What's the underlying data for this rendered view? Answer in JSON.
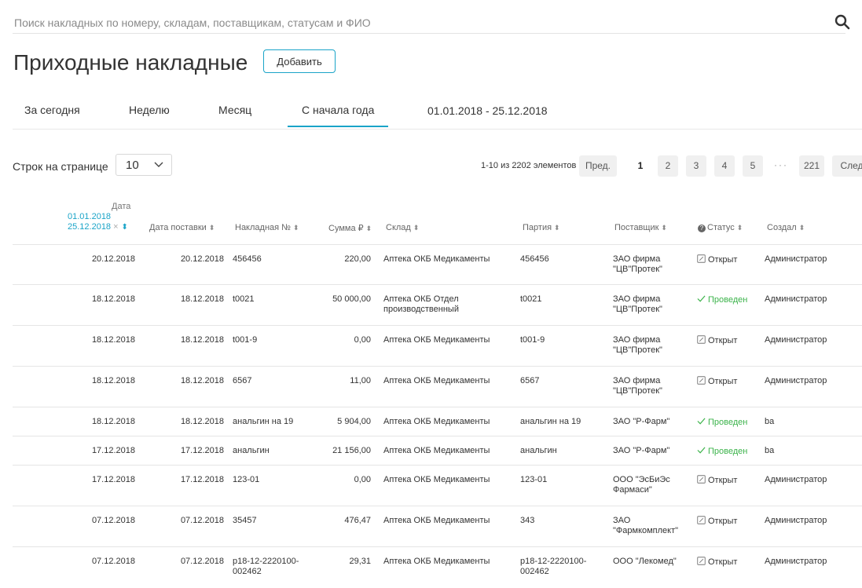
{
  "search": {
    "placeholder": "Поиск накладных по номеру, складам, поставщикам, статусам и ФИО"
  },
  "page": {
    "title": "Приходные накладные",
    "add_label": "Добавить"
  },
  "tabs": [
    {
      "label": "За сегодня"
    },
    {
      "label": "Неделю"
    },
    {
      "label": "Месяц"
    },
    {
      "label": "С начала года"
    },
    {
      "label": "01.01.2018 - 25.12.2018"
    }
  ],
  "active_tab": 3,
  "pager": {
    "rows_label": "Строк на странице",
    "rows_value": "10",
    "info": "1-10 из 2202 элементов",
    "prev": "Пред.",
    "next": "След",
    "pages": [
      "1",
      "2",
      "3",
      "4",
      "5"
    ],
    "dots": "···",
    "last": "221"
  },
  "columns": {
    "date_caption": "Дата",
    "date_from": "01.01.2018",
    "date_to": "25.12.2018",
    "delivery": "Дата поставки",
    "number": "Накладная №",
    "sum": "Сумма ₽",
    "warehouse": "Склад",
    "batch": "Партия",
    "supplier": "Поставщик",
    "status": "Статус",
    "creator": "Создал"
  },
  "rows": [
    {
      "date": "20.12.2018",
      "delivery": "20.12.2018",
      "number": "456456",
      "sum": "220,00",
      "warehouse": "Аптека ОКБ Медикаменты",
      "batch": "456456",
      "supplier": "ЗАО фирма \"ЦВ\"Протек\"",
      "status": "Открыт",
      "creator": "Администратор"
    },
    {
      "date": "18.12.2018",
      "delivery": "18.12.2018",
      "number": "t0021",
      "sum": "50 000,00",
      "warehouse": "Аптека ОКБ Отдел производственный",
      "batch": "t0021",
      "supplier": "ЗАО фирма \"ЦВ\"Протек\"",
      "status": "Проведен",
      "creator": "Администратор"
    },
    {
      "date": "18.12.2018",
      "delivery": "18.12.2018",
      "number": "t001-9",
      "sum": "0,00",
      "warehouse": "Аптека ОКБ Медикаменты",
      "batch": "t001-9",
      "supplier": "ЗАО фирма \"ЦВ\"Протек\"",
      "status": "Открыт",
      "creator": "Администратор"
    },
    {
      "date": "18.12.2018",
      "delivery": "18.12.2018",
      "number": "6567",
      "sum": "11,00",
      "warehouse": "Аптека ОКБ Медикаменты",
      "batch": "6567",
      "supplier": "ЗАО фирма \"ЦВ\"Протек\"",
      "status": "Открыт",
      "creator": "Администратор"
    },
    {
      "date": "18.12.2018",
      "delivery": "18.12.2018",
      "number": "анальгин на 19",
      "sum": "5 904,00",
      "warehouse": "Аптека ОКБ Медикаменты",
      "batch": "анальгин на 19",
      "supplier": "ЗАО \"Р-Фарм\"",
      "status": "Проведен",
      "creator": "ba"
    },
    {
      "date": "17.12.2018",
      "delivery": "17.12.2018",
      "number": "анальгин",
      "sum": "21 156,00",
      "warehouse": "Аптека ОКБ Медикаменты",
      "batch": "анальгин",
      "supplier": "ЗАО \"Р-Фарм\"",
      "status": "Проведен",
      "creator": "ba"
    },
    {
      "date": "17.12.2018",
      "delivery": "17.12.2018",
      "number": "123-01",
      "sum": "0,00",
      "warehouse": "Аптека ОКБ Медикаменты",
      "batch": "123-01",
      "supplier": "ООО \"ЭсБиЭс Фармаси\"",
      "status": "Открыт",
      "creator": "Администратор"
    },
    {
      "date": "07.12.2018",
      "delivery": "07.12.2018",
      "number": "35457",
      "sum": "476,47",
      "warehouse": "Аптека ОКБ Медикаменты",
      "batch": "343",
      "supplier": "ЗАО \"Фармкомплект\"",
      "status": "Открыт",
      "creator": "Администратор"
    },
    {
      "date": "07.12.2018",
      "delivery": "07.12.2018",
      "number": "p18-12-2220100-002462",
      "sum": "29,31",
      "warehouse": "Аптека ОКБ Медикаменты",
      "batch": "p18-12-2220100-002462",
      "supplier": "ООО \"Лекомед\"",
      "status": "Открыт",
      "creator": "Администратор"
    }
  ],
  "colors": {
    "accent": "#1aa4c8",
    "success": "#3bb34a"
  }
}
